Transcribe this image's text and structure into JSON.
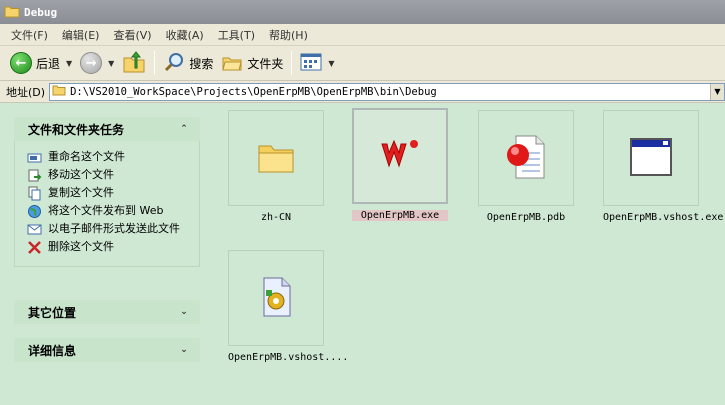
{
  "window": {
    "title": "Debug"
  },
  "menu": [
    "文件(F)",
    "编辑(E)",
    "查看(V)",
    "收藏(A)",
    "工具(T)",
    "帮助(H)"
  ],
  "toolbar": {
    "back_label": "后退",
    "search_label": "搜索",
    "folders_label": "文件夹"
  },
  "address": {
    "label": "地址(D)",
    "path": "D:\\VS2010_WorkSpace\\Projects\\OpenErpMB\\OpenErpMB\\bin\\Debug"
  },
  "tasks_panel": {
    "title": "文件和文件夹任务",
    "items": [
      {
        "label": "重命名这个文件",
        "icon": "rename-icon"
      },
      {
        "label": "移动这个文件",
        "icon": "move-icon"
      },
      {
        "label": "复制这个文件",
        "icon": "copy-icon"
      },
      {
        "label": "将这个文件发布到 Web",
        "icon": "publish-web-icon"
      },
      {
        "label": "以电子邮件形式发送此文件",
        "icon": "email-icon"
      },
      {
        "label": "删除这个文件",
        "icon": "delete-icon"
      }
    ]
  },
  "other_places_panel": {
    "title": "其它位置"
  },
  "details_panel": {
    "title": "详细信息"
  },
  "files": [
    {
      "name": "zh-CN",
      "icon": "folder-icon",
      "selected": false
    },
    {
      "name": "OpenErpMB.exe",
      "icon": "app-w-icon",
      "selected": true
    },
    {
      "name": "OpenErpMB.pdb",
      "icon": "pdb-document-icon",
      "selected": false
    },
    {
      "name": "OpenErpMB.vshost.exe",
      "icon": "window-app-icon",
      "selected": false
    },
    {
      "name": "OpenErpMB.vshost....",
      "icon": "config-file-icon",
      "selected": false
    }
  ],
  "colors": {
    "explorer_bg": "#cfe8d3",
    "toolbar_bg": "#ece9d8",
    "selection_name_bg": "#e3c6c6"
  }
}
